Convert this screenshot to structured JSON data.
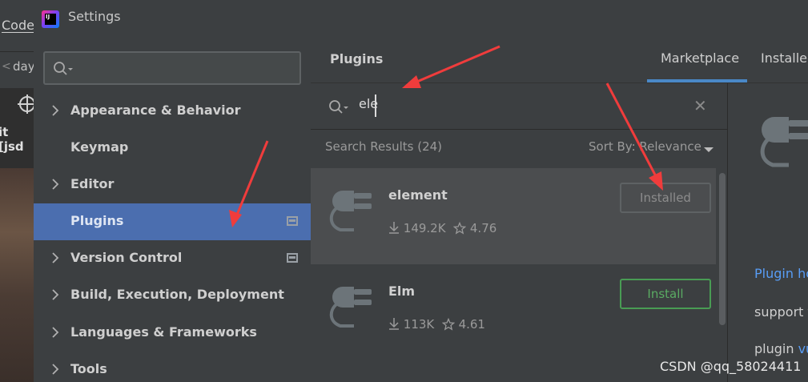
{
  "background_ide": {
    "menu_code": "Code",
    "tab_label": "day",
    "code_text": "it [jsd"
  },
  "window": {
    "title": "Settings"
  },
  "nav": {
    "search_placeholder": "",
    "items": [
      {
        "label": "Appearance & Behavior",
        "expandable": true,
        "selected": false,
        "project_icon": false
      },
      {
        "label": "Keymap",
        "expandable": false,
        "selected": false,
        "project_icon": false
      },
      {
        "label": "Editor",
        "expandable": true,
        "selected": false,
        "project_icon": false
      },
      {
        "label": "Plugins",
        "expandable": false,
        "selected": true,
        "project_icon": true
      },
      {
        "label": "Version Control",
        "expandable": true,
        "selected": false,
        "project_icon": true
      },
      {
        "label": "Build, Execution, Deployment",
        "expandable": true,
        "selected": false,
        "project_icon": false
      },
      {
        "label": "Languages & Frameworks",
        "expandable": true,
        "selected": false,
        "project_icon": false
      },
      {
        "label": "Tools",
        "expandable": true,
        "selected": false,
        "project_icon": false
      }
    ],
    "selected_color": "#4b6eaf"
  },
  "plugins": {
    "title": "Plugins",
    "tabs": {
      "marketplace": "Marketplace",
      "installed": "Installed"
    },
    "search_query": "ele",
    "clear_icon": "close-icon",
    "results_label": "Search Results (24)",
    "sort_label": "Sort By: Relevance",
    "results": [
      {
        "name": "element",
        "downloads": "149.2K",
        "rating": "4.76",
        "button": "Installed",
        "state": "installed"
      },
      {
        "name": "Elm",
        "downloads": "113K",
        "rating": "4.61",
        "button": "Install",
        "state": "install"
      }
    ],
    "install_color": "#499c54"
  },
  "detail": {
    "homepage_link": "Plugin ho",
    "support_text": "support f",
    "plugin_text": "plugin ",
    "plugin_link": "vu"
  },
  "watermark": "CSDN @qq_58024411",
  "annotation_color": "#f03c3c"
}
